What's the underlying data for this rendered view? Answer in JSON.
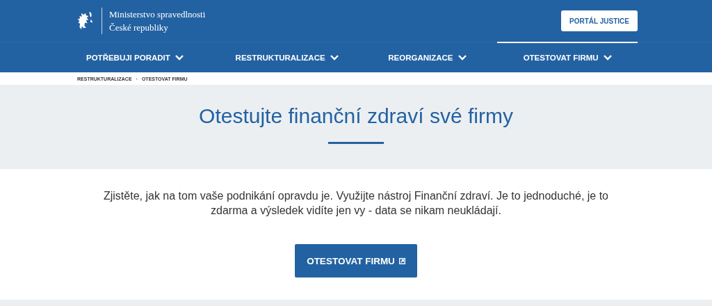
{
  "header": {
    "logo_line_1": "Ministerstvo spravedlnosti",
    "logo_line_2": "České republiky",
    "portal_button": "PORTÁL JUSTICE"
  },
  "nav": [
    {
      "label": "POTŘEBUJI PORADIT",
      "selected": false
    },
    {
      "label": "RESTRUKTURALIZACE",
      "selected": false
    },
    {
      "label": "REORGANIZACE",
      "selected": false
    },
    {
      "label": "OTESTOVAT FIRMU",
      "selected": true
    }
  ],
  "breadcrumb": {
    "items": [
      "RESTRUKTURALIZACE",
      "OTESTOVAT FIRMU"
    ],
    "separator": "›"
  },
  "hero": {
    "title": "Otestujte finanční zdraví své firmy"
  },
  "intro": "Zjistěte, jak na tom vaše podnikání opravdu je. Využijte nástroj Finanční zdraví. Je to jednoduché, je to zdarma a výsledek vidíte jen vy - data se nikam neukládají.",
  "cta_button": "OTESTOVAT FIRMU"
}
